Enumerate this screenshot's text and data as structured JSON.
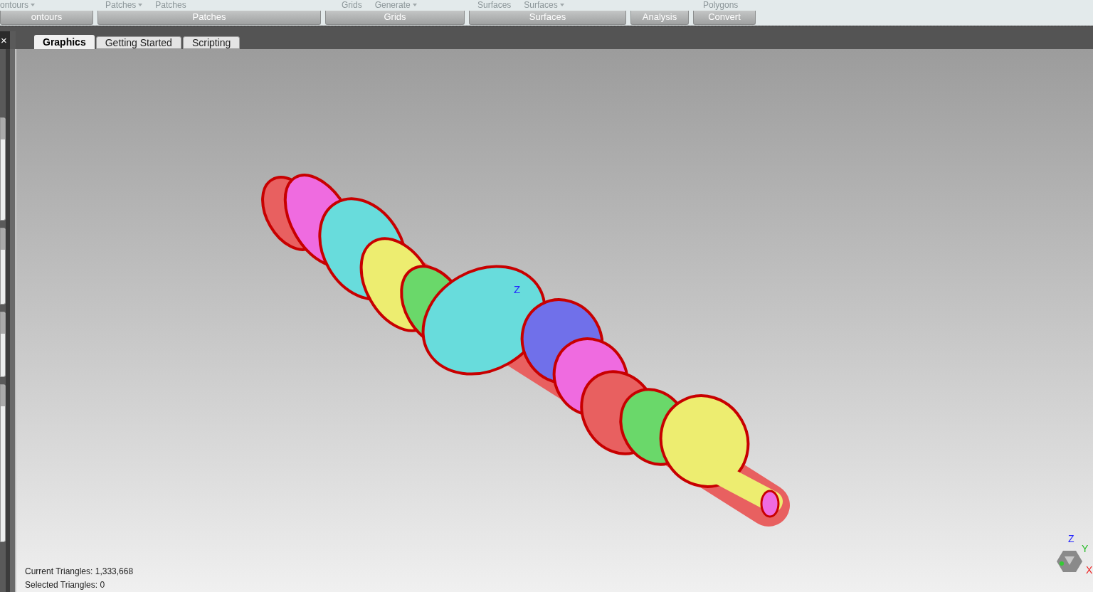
{
  "ribbon": {
    "groups": [
      {
        "label": "ontours",
        "items": [
          {
            "label": "ontours",
            "dropdown": true
          }
        ]
      },
      {
        "label": "Patches",
        "items": [
          {
            "label": "Patches",
            "dropdown": true
          },
          {
            "label": "Patches",
            "dropdown": false
          }
        ]
      },
      {
        "label": "Grids",
        "items": [
          {
            "label": "Grids",
            "dropdown": false
          },
          {
            "label": "Generate",
            "dropdown": true
          }
        ]
      },
      {
        "label": "Surfaces",
        "items": [
          {
            "label": "Surfaces",
            "dropdown": false
          },
          {
            "label": "Surfaces",
            "dropdown": true
          }
        ]
      },
      {
        "label": "Analysis"
      },
      {
        "label": "Convert",
        "items": [
          {
            "label": "Polygons",
            "dropdown": false
          }
        ]
      }
    ]
  },
  "panel_close": "×",
  "tabs": [
    {
      "label": "Graphics",
      "selected": true
    },
    {
      "label": "Getting Started",
      "selected": false
    },
    {
      "label": "Scripting",
      "selected": false
    }
  ],
  "viewport": {
    "center_axis_label": "Z",
    "triad": {
      "z": "Z",
      "y": "Y",
      "x": "X"
    }
  },
  "status": [
    "Current Triangles: 1,333,668",
    "Selected Triangles: 0"
  ]
}
